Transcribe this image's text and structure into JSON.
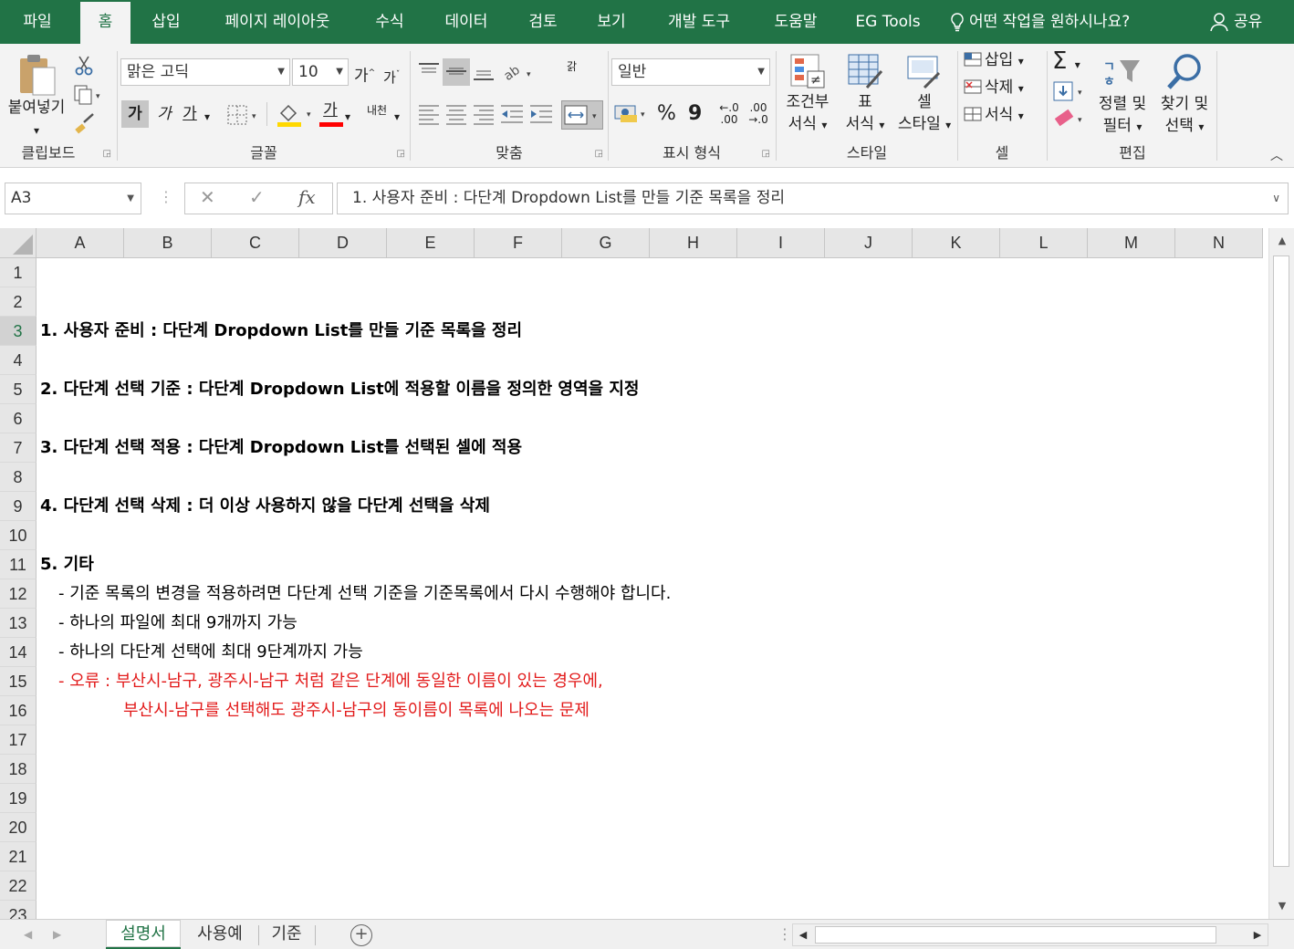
{
  "tabs": [
    "파일",
    "홈",
    "삽입",
    "페이지 레이아웃",
    "수식",
    "데이터",
    "검토",
    "보기",
    "개발 도구",
    "도움말",
    "EG Tools"
  ],
  "active_tab": "홈",
  "tell_me": "어떤 작업을 원하시나요?",
  "share": "공유",
  "ribbon": {
    "clipboard": {
      "label": "클립보드",
      "paste": "붙여넣기"
    },
    "font": {
      "label": "글꼴",
      "font_name": "맑은 고딕",
      "font_size": "10",
      "grow": "가",
      "shrink": "가",
      "bold": "가",
      "italic": "가",
      "underline": "가",
      "font_color": "가",
      "phonetic": "내천"
    },
    "alignment": {
      "label": "맞춤",
      "wrap": "갉"
    },
    "number": {
      "label": "표시 형식",
      "format": "일반",
      "percent": "%",
      "comma": "9",
      "inc_dec": "←.0 .00",
      "dec_dec": ".00 →.0"
    },
    "styles": {
      "label": "스타일",
      "cond_format_1": "조건부",
      "cond_format_2": "서식",
      "table_1": "표",
      "table_2": "서식",
      "cell_style_1": "셀",
      "cell_style_2": "스타일"
    },
    "cells": {
      "label": "셀",
      "insert": "삽입",
      "delete": "삭제",
      "format": "서식"
    },
    "editing": {
      "label": "편집",
      "sort_1": "정렬 및",
      "sort_2": "필터",
      "find_1": "찾기 및",
      "find_2": "선택"
    }
  },
  "formula_bar": {
    "name_box": "A3",
    "cancel": "✕",
    "enter": "✓",
    "fx": "fx",
    "content": "1. 사용자 준비 : 다단계 Dropdown List를 만들 기준 목록을 정리"
  },
  "columns": [
    "A",
    "B",
    "C",
    "D",
    "E",
    "F",
    "G",
    "H",
    "I",
    "J",
    "K",
    "L",
    "M",
    "N"
  ],
  "rows": [
    "1",
    "2",
    "3",
    "4",
    "5",
    "6",
    "7",
    "8",
    "9",
    "10",
    "11",
    "12",
    "13",
    "14",
    "15",
    "16",
    "17",
    "18",
    "19",
    "20",
    "21",
    "22",
    "23"
  ],
  "selected_row": "3",
  "cells": [
    {
      "row": "3",
      "text": "1. 사용자 준비 : 다단계 Dropdown List를 만들 기준 목록을 정리",
      "style": "bold"
    },
    {
      "row": "5",
      "text": "2. 다단계 선택 기준 : 다단계 Dropdown List에 적용할 이름을 정의한 영역을 지정",
      "style": "bold"
    },
    {
      "row": "7",
      "text": "3. 다단계 선택 적용 : 다단계 Dropdown List를 선택된 셀에 적용",
      "style": "bold"
    },
    {
      "row": "9",
      "text": "4. 다단계 선택 삭제 : 더 이상 사용하지 않을 다단계 선택을 삭제",
      "style": "bold"
    },
    {
      "row": "11",
      "text": "5. 기타",
      "style": "bold"
    },
    {
      "row": "12",
      "text": "- 기준 목록의 변경을 적용하려면 다단계 선택 기준을 기준목록에서 다시 수행해야 합니다.",
      "style": "normal"
    },
    {
      "row": "13",
      "text": "- 하나의 파일에 최대 9개까지 가능",
      "style": "normal"
    },
    {
      "row": "14",
      "text": "- 하나의 다단계 선택에 최대 9단계까지 가능",
      "style": "normal"
    },
    {
      "row": "15",
      "text": "- 오류 : 부산시-남구, 광주시-남구 처럼 같은 단계에 동일한 이름이 있는 경우에,",
      "style": "red"
    },
    {
      "row": "16",
      "text": "부산시-남구를 선택해도 광주시-남구의 동이름이 목록에 나오는 문제",
      "style": "red"
    }
  ],
  "sheets": [
    "설명서",
    "사용예",
    "기준"
  ],
  "active_sheet": "설명서",
  "colors": {
    "brand": "#217346",
    "error_text": "#e21a1a"
  }
}
